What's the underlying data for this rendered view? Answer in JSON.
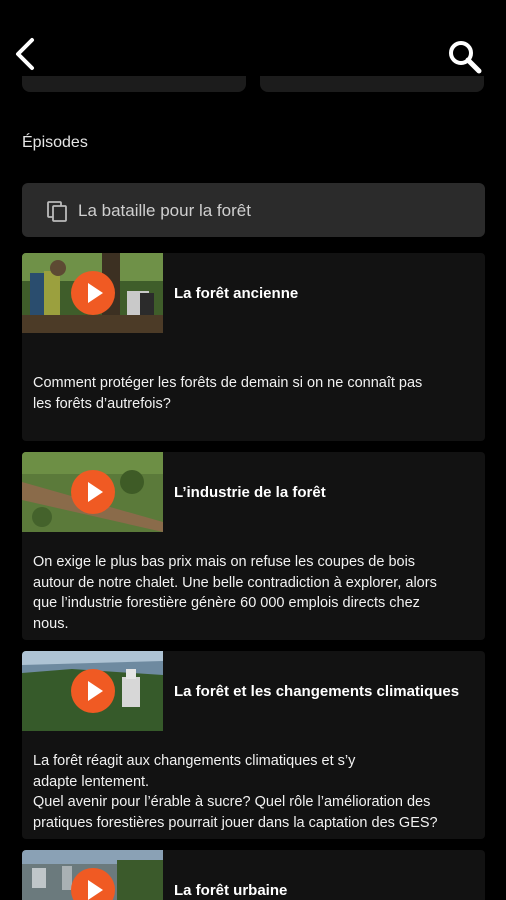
{
  "section_title": "Épisodes",
  "season": {
    "label": "La bataille pour la forêt",
    "icon": "copy-stack-icon"
  },
  "episodes": [
    {
      "title": "La forêt ancienne",
      "description": "Comment protéger les forêts de demain si on ne connaît pas\nles forêts d’autrefois?"
    },
    {
      "title": "L’industrie de la forêt",
      "description": "On exige le plus bas prix mais on refuse les coupes de bois\nautour de notre chalet. Une belle contradiction à explorer, alors\nque l’industrie forestière génère 60 000 emplois directs chez\nnous."
    },
    {
      "title": "La forêt et les changements climatiques",
      "description": "La forêt réagit aux changements climatiques et s’y\nadapte lentement.\nQuel avenir pour l’érable à sucre? Quel rôle l’amélioration des\npratiques forestières pourrait jouer dans la captation des GES?"
    },
    {
      "title": "La forêt urbaine",
      "description": ""
    }
  ],
  "colors": {
    "accent": "#f05a23",
    "background": "#000000",
    "card": "#121212",
    "select": "#2b2b2b"
  },
  "icons": {
    "back": "back-arrow-icon",
    "search": "search-icon",
    "play": "play-icon"
  }
}
